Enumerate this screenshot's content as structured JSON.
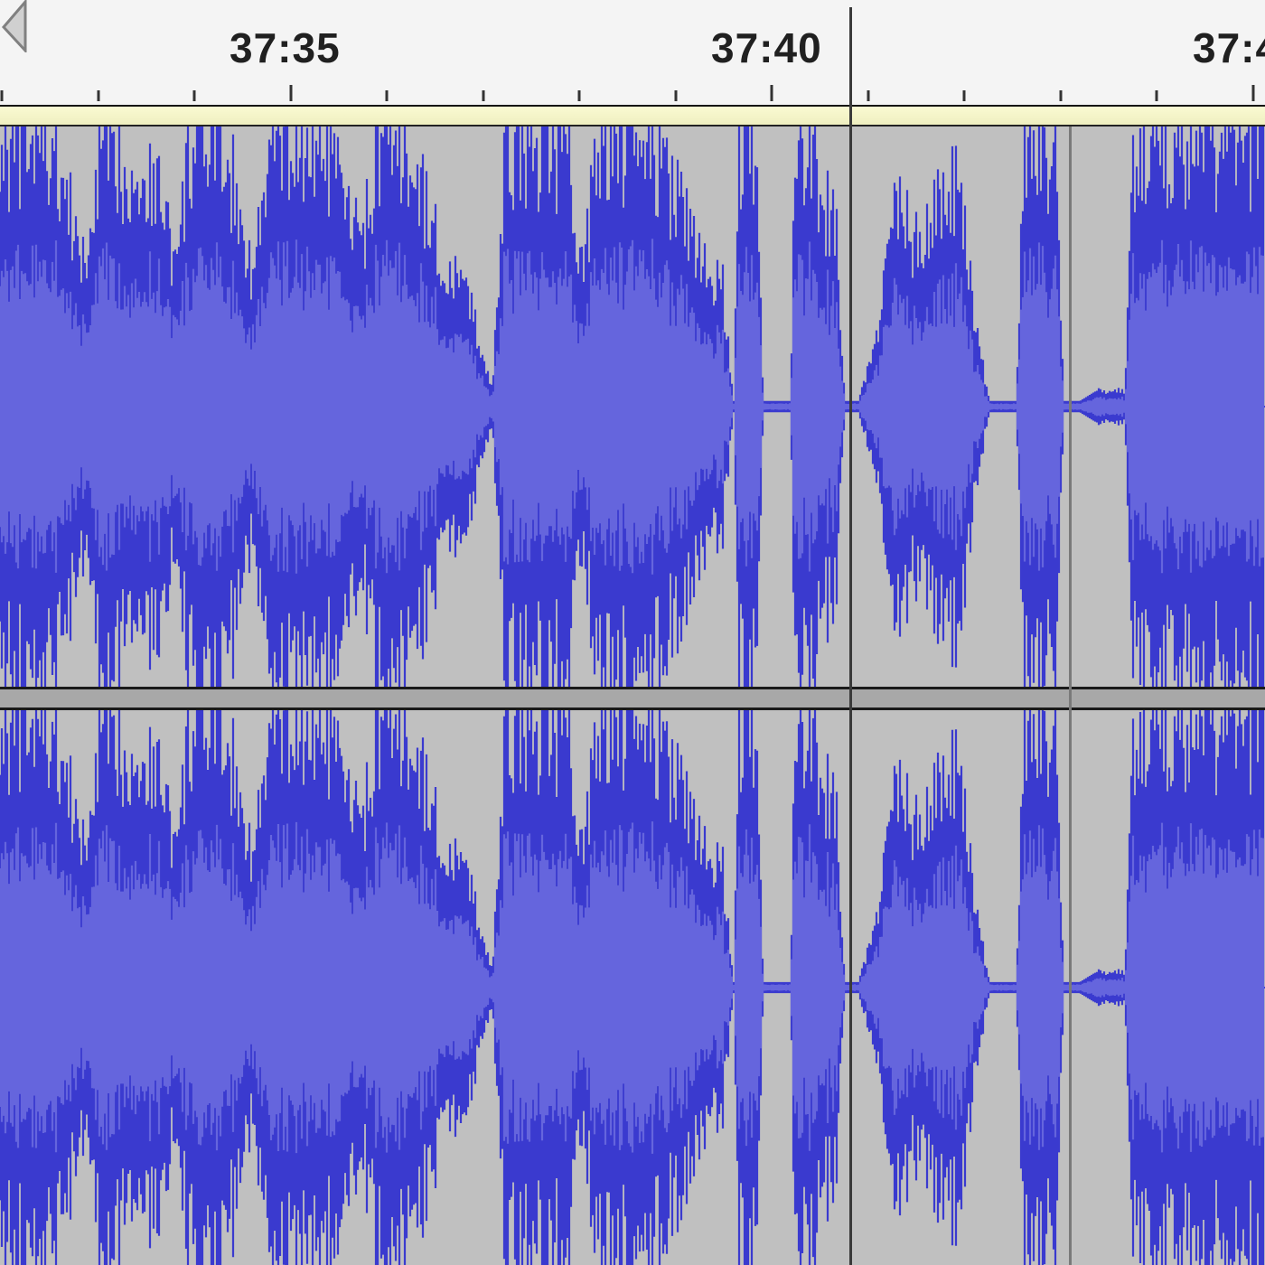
{
  "app": "Audacity",
  "timeline": {
    "labels": [
      "37:35",
      "37:40",
      "37:4"
    ]
  },
  "waveform": {
    "channels": 2,
    "peak_color": "#3a3acf",
    "rms_color": "#6565dd",
    "background_color": "#c0c0c0"
  }
}
